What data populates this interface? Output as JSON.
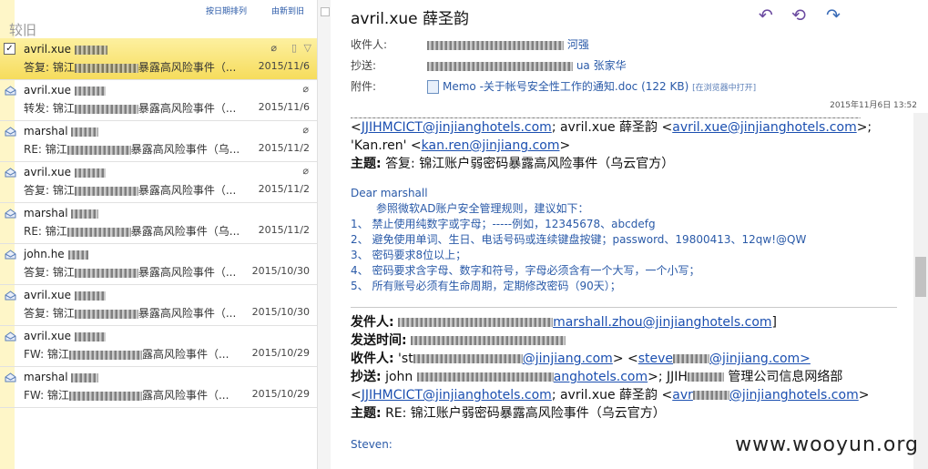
{
  "list": {
    "sort_label": "按日期排列",
    "sort_order": "由新到旧",
    "group_header": "较旧",
    "items": [
      {
        "from": "avril.xue",
        "subject": "答复: 锦江",
        "subject_tail": "暴露高风险事件（...",
        "date": "2015/11/6",
        "selected": true,
        "attachment": true
      },
      {
        "from": "avril.xue",
        "subject": "转发: 锦江",
        "subject_tail": "暴露高风险事件（...",
        "date": "2015/11/6",
        "selected": false,
        "attachment": true
      },
      {
        "from": "marshal",
        "subject": "RE: 锦江",
        "subject_tail": "暴露高风险事件（乌...",
        "date": "2015/11/2",
        "selected": false,
        "attachment": true
      },
      {
        "from": "avril.xue",
        "subject": "答复: 锦江",
        "subject_tail": "暴露高风险事件（...",
        "date": "2015/11/2",
        "selected": false,
        "attachment": true
      },
      {
        "from": "marshal",
        "subject": "RE: 锦江",
        "subject_tail": "暴露高风险事件（乌...",
        "date": "2015/11/2",
        "selected": false,
        "attachment": false
      },
      {
        "from": "john.he",
        "subject": "答复: 锦江",
        "subject_tail": "暴露高风险事件（...",
        "date": "2015/10/30",
        "selected": false,
        "attachment": false
      },
      {
        "from": "avril.xue",
        "subject": "答复: 锦江",
        "subject_tail": "暴露高风险事件（...",
        "date": "2015/10/30",
        "selected": false,
        "attachment": false
      },
      {
        "from": "avril.xue",
        "subject": "FW: 锦江",
        "subject_tail": "露高风险事件（...",
        "date": "2015/10/29",
        "selected": false,
        "attachment": false
      },
      {
        "from": "marshal",
        "subject": "FW: 锦江",
        "subject_tail": "露高风险事件（...",
        "date": "2015/10/29",
        "selected": false,
        "attachment": false
      }
    ]
  },
  "message": {
    "sender": "avril.xue 薛圣韵",
    "to_label": "收件人:",
    "to_value": "河强",
    "cc_label": "抄送:",
    "cc_value": "ua 张家华",
    "attach_label": "附件:",
    "attach_name": "Memo -关于帐号安全性工作的通知.doc (122 KB)",
    "attach_open": "[在浏览器中打开]",
    "timestamp": "2015年11月6日   13:52",
    "quoted_top": {
      "line1_link": "JJIHMCICT@jinjianghotels.com",
      "line1_mid": "; avril.xue 薛圣韵 <",
      "line1_link2": "avril.xue@jinjianghotels.com",
      "line1_end": ">;",
      "line2_prefix": "'Kan.ren' <",
      "line2_link": "kan.ren@jinjiang.com",
      "line2_end": ">",
      "subject_label": "主题:",
      "subject_value": "答复: 锦江账户弱密码暴露高风险事件（乌云官方）"
    },
    "body": {
      "greeting": "Dear marshall",
      "intro": "参照微软AD账户安全管理规则，建议如下：",
      "rules": [
        "1、 禁止使用纯数字或字母；-----例如，12345678、abcdefg",
        "2、 避免使用单词、生日、电话号码或连续键盘按键；password、19800413、12qw!@QW",
        "3、 密码要求8位以上；",
        "4、 密码要求含字母、数字和符号，字母必须含有一个大写，一个小写；",
        "5、 所有账号必须有生命周期，定期修改密码（90天）；"
      ]
    },
    "forward": {
      "from_label": "发件人:",
      "from_value": "marshall.zhou@jinjianghotels.com",
      "sent_label": "发送时间:",
      "to_label": "收件人:",
      "to_link1": "@jinjiang.com",
      "to_link2": "steve",
      "to_tail": "@jinjiang.com>",
      "cc_label": "抄送:",
      "cc_john": "john",
      "cc_link": "anghotels.com",
      "cc_tail": "; JJIH",
      "cc_org": "管理公司信息网络部",
      "cc2_link": "JJIHMCICT@jinjianghotels.com",
      "cc2_mid": "; avril.xue 薛圣韵 <",
      "cc2_link2": "@jinjianghotels.com",
      "subject_label": "主题:",
      "subject_value": "RE: 锦江账户弱密码暴露高风险事件（乌云官方）",
      "next": "Steven:"
    }
  },
  "watermark": "www.wooyun.org"
}
